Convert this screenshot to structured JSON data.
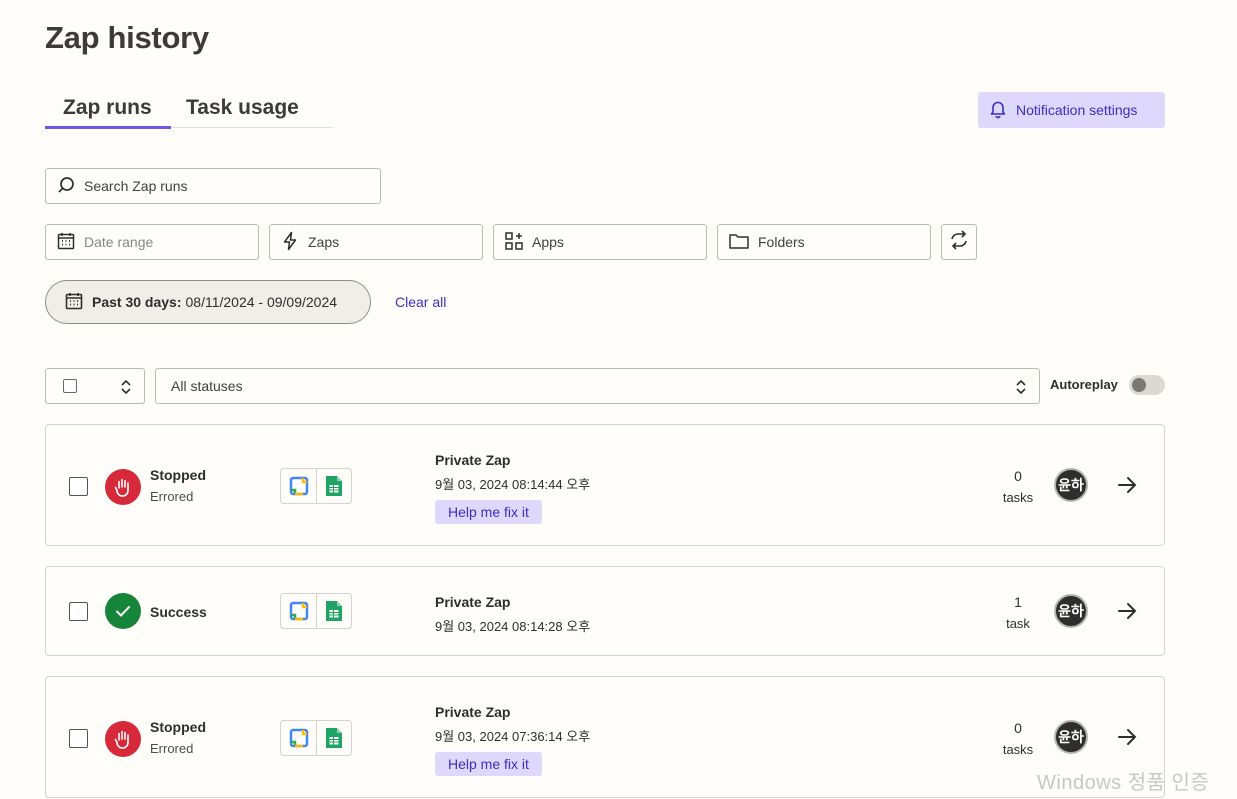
{
  "page": {
    "title": "Zap history"
  },
  "tabs": [
    {
      "label": "Zap runs",
      "active": true
    },
    {
      "label": "Task usage",
      "active": false
    }
  ],
  "notification_button": {
    "label": "Notification settings",
    "icon": "bell-icon"
  },
  "search": {
    "placeholder": "Search Zap runs",
    "value": ""
  },
  "filters": {
    "date_range": "Date range",
    "zaps": "Zaps",
    "apps": "Apps",
    "folders": "Folders"
  },
  "active_filter": {
    "label": "Past 30 days:",
    "value": "08/11/2024 - 09/09/2024",
    "clear": "Clear all"
  },
  "toolbar": {
    "status_select": "All statuses",
    "autoreplay_label": "Autoreplay",
    "autoreplay_on": false
  },
  "runs": [
    {
      "status": "Stopped",
      "substatus": "Errored",
      "status_kind": "error",
      "zap_name": "Private Zap",
      "time": "9월 03, 2024 08:14:44 오후",
      "fix_label": "Help me fix it",
      "task_count": "0",
      "task_unit": "tasks",
      "avatar": "윤하"
    },
    {
      "status": "Success",
      "substatus": "",
      "status_kind": "success",
      "zap_name": "Private Zap",
      "time": "9월 03, 2024 08:14:28 오후",
      "fix_label": "",
      "task_count": "1",
      "task_unit": "task",
      "avatar": "윤하"
    },
    {
      "status": "Stopped",
      "substatus": "Errored",
      "status_kind": "error",
      "zap_name": "Private Zap",
      "time": "9월 03, 2024 07:36:14 오후",
      "fix_label": "Help me fix it",
      "task_count": "0",
      "task_unit": "tasks",
      "avatar": "윤하"
    }
  ],
  "watermark": "Windows 정품 인증",
  "colors": {
    "accent": "#695be8",
    "error": "#d6293a",
    "success": "#16853a",
    "chip_bg": "#ddd8fc"
  }
}
